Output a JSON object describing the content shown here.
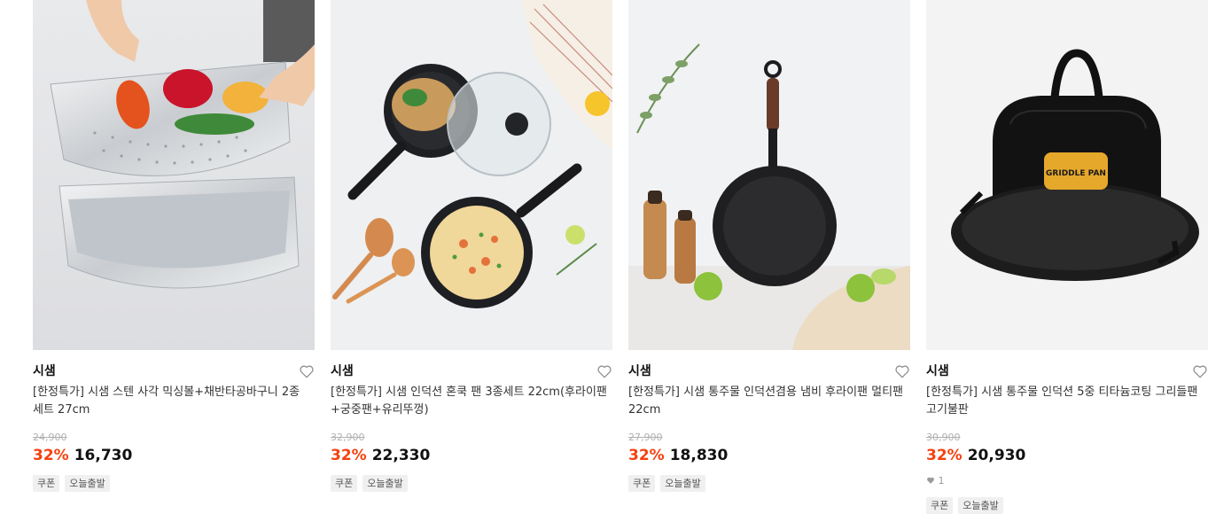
{
  "products": [
    {
      "brand": "시샘",
      "name": "[한정특가] 시샘 스텐 사각 믹싱볼+채반타공바구니 2종 세트 27cm",
      "original_price": "24,900",
      "discount": "32%",
      "price": "16,730",
      "likes": null,
      "tags": [
        "쿠폰",
        "오늘출발"
      ],
      "image": "stainless-mixing-bowl-colander-set"
    },
    {
      "brand": "시샘",
      "name": "[한정특가] 시샘 인덕션 혼쿡 팬 3종세트 22cm(후라이팬+궁중팬+유리뚜껑)",
      "original_price": "32,900",
      "discount": "32%",
      "price": "22,330",
      "likes": null,
      "tags": [
        "쿠폰",
        "오늘출발"
      ],
      "image": "frying-pan-wok-glass-lid-set"
    },
    {
      "brand": "시샘",
      "name": "[한정특가] 시샘 통주물 인덕션겸용 냄비 후라이팬 멀티팬 22cm",
      "original_price": "27,900",
      "discount": "32%",
      "price": "18,830",
      "likes": null,
      "tags": [
        "쿠폰",
        "오늘출발"
      ],
      "image": "cast-iron-frying-pan"
    },
    {
      "brand": "시샘",
      "name": "[한정특가] 시샘 통주물 인덕션 5중 티타늄코팅 그리들팬 고기불판",
      "original_price": "30,900",
      "discount": "32%",
      "price": "20,930",
      "likes": "1",
      "tags": [
        "쿠폰",
        "오늘출발"
      ],
      "image": "griddle-pan-with-bag",
      "image_text": "GRIDDLE PAN"
    }
  ],
  "colors": {
    "discount": "#f5410f",
    "tag_bg": "#f0f0f0",
    "strike": "#b0b0b0"
  }
}
